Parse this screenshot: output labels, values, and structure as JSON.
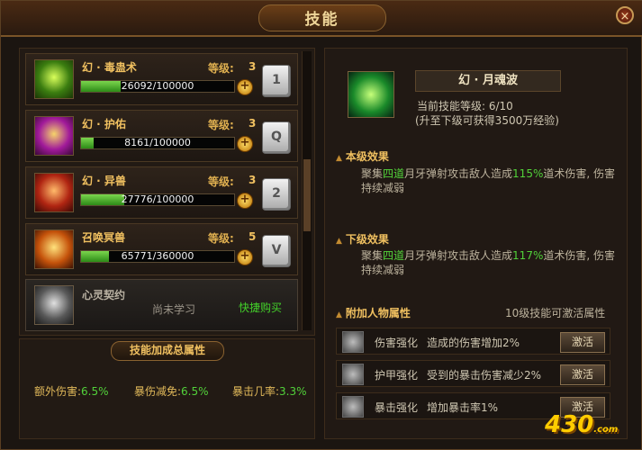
{
  "window": {
    "title": "技能",
    "close_label": "×"
  },
  "skills": [
    {
      "name": "幻 · 毒蛊术",
      "level_label": "等级:",
      "level": "3",
      "exp": "26092/100000",
      "progress": 0.26,
      "plus": "+",
      "key": "1",
      "icon": "poison-skull-icon"
    },
    {
      "name": "幻 · 护佑",
      "level_label": "等级:",
      "level": "3",
      "exp": "8161/100000",
      "progress": 0.08,
      "plus": "+",
      "key": "Q",
      "icon": "purple-shield-icon"
    },
    {
      "name": "幻 · 异兽",
      "level_label": "等级:",
      "level": "3",
      "exp": "27776/100000",
      "progress": 0.28,
      "plus": "+",
      "key": "2",
      "icon": "beast-summon-icon"
    },
    {
      "name": "召唤冥兽",
      "level_label": "等级:",
      "level": "5",
      "exp": "65771/360000",
      "progress": 0.18,
      "plus": "+",
      "key": "V",
      "icon": "demon-beast-icon"
    }
  ],
  "unlearned": {
    "name": "心灵契约",
    "status": "尚未学习",
    "buy": "快捷购买",
    "icon": "meditation-icon"
  },
  "bonus": {
    "title": "技能加成总属性",
    "items": [
      {
        "label": "额外伤害:",
        "value": "6.5%"
      },
      {
        "label": "暴伤减免:",
        "value": "6.5%"
      },
      {
        "label": "暴击几率:",
        "value": "3.3%"
      }
    ]
  },
  "detail": {
    "name": "幻 · 月魂波",
    "current_level": "当前技能等级: 6/10",
    "next_level_note": "(升至下级可获得3500万经验)",
    "this_level_head": "本级效果",
    "this_level_desc_pre": "聚集",
    "this_level_desc_g1": "四道",
    "this_level_desc_mid": "月牙弹射攻击敌人造成",
    "this_level_desc_g2": "115%",
    "this_level_desc_post": "道术伤害, 伤害持续减弱",
    "next_level_head": "下级效果",
    "next_level_desc_pre": "聚集",
    "next_level_desc_g1": "四道",
    "next_level_desc_mid": "月牙弹射攻击敌人造成",
    "next_level_desc_g2": "117%",
    "next_level_desc_post": "道术伤害, 伤害持续减弱",
    "attr_head": "附加人物属性",
    "attr_note": "10级技能可激活属性",
    "attrs": [
      {
        "name": "伤害强化",
        "desc": "造成的伤害增加2%",
        "button": "激活"
      },
      {
        "name": "护甲强化",
        "desc": "受到的暴击伤害减少2%",
        "button": "激活"
      },
      {
        "name": "暴击强化",
        "desc": "增加暴击率1%",
        "button": "激活"
      }
    ]
  },
  "logo": {
    "main": "430",
    "sub": ".com"
  },
  "colors": {
    "accent": "#f0c060",
    "green": "#52d23a",
    "progress": "#3da81f"
  }
}
